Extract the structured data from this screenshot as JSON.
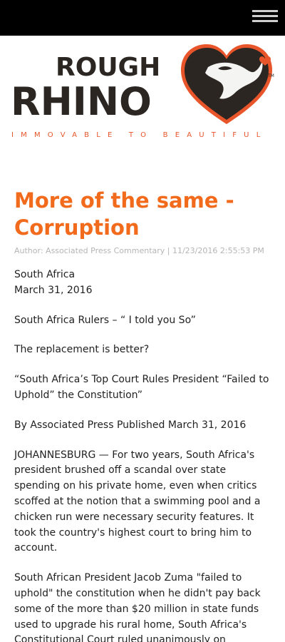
{
  "header": {
    "menu_icon": "hamburger-menu-icon"
  },
  "logo": {
    "line1": "ROUGH",
    "line2": "RHINO",
    "tagline": "IMMOVABLE TO BEAUTIFUL",
    "trademark": "TM",
    "colors": {
      "dark": "#2b2622",
      "accent": "#e8552a"
    }
  },
  "article": {
    "title": "More of the same - Corruption",
    "meta": "Author: Associated Press Commentary | 11/23/2016 2:55:53 PM",
    "dateline_location": "South Africa",
    "dateline_date": "March 31, 2016",
    "paragraphs": [
      "South Africa Rulers – “ I told you So”",
      "The replacement is better?",
      "“South Africa’s Top Court Rules President “Failed to Uphold” the Constitution”",
      "By Associated Press Published March 31, 2016",
      "JOHANNESBURG — For two years, South Africa's president brushed off a scandal over state spending on his private home, even when critics scoffed at the notion that a swimming pool and a chicken run were necessary security features. It took the country's highest court to bring him to account.",
      "South African President Jacob Zuma \"failed to uphold\" the constitution when he didn't pay back some of the more than $20 million in state funds used to upgrade his rural home, South Africa's Constitutional Court ruled unanimously on"
    ]
  },
  "colors": {
    "title": "#f26a1b",
    "topbar": "#000000",
    "meta": "#b5b5b5"
  }
}
